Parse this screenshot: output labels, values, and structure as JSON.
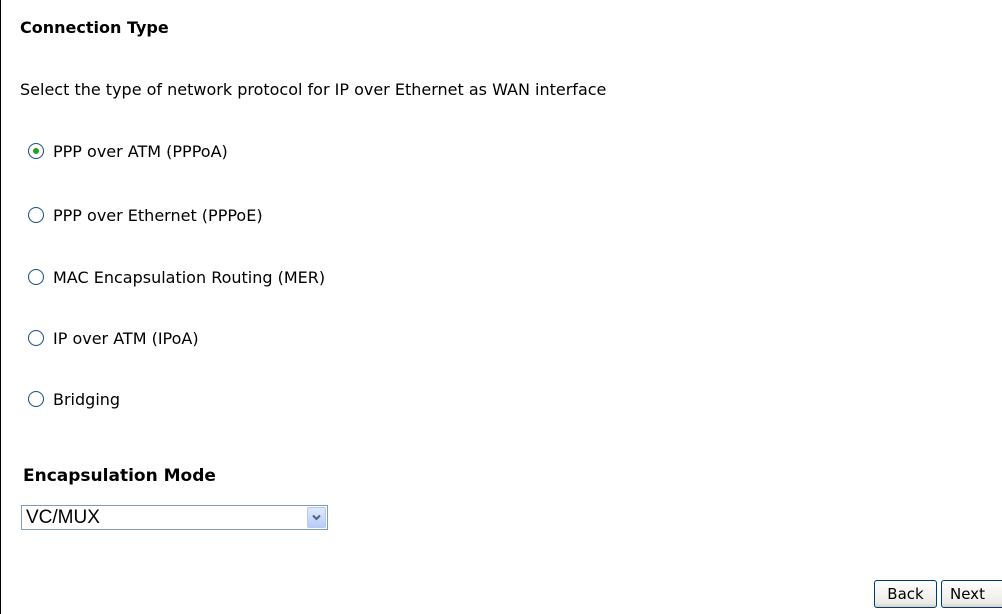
{
  "header": {
    "title": "Connection Type"
  },
  "description": "Select the type of network protocol for IP over Ethernet as WAN interface",
  "connection_types": {
    "selected_index": 0,
    "options": [
      {
        "label": "PPP over ATM (PPPoA)",
        "checked": true
      },
      {
        "label": "PPP over Ethernet (PPPoE)",
        "checked": false
      },
      {
        "label": "MAC Encapsulation Routing (MER)",
        "checked": false
      },
      {
        "label": "IP over ATM (IPoA)",
        "checked": false
      },
      {
        "label": "Bridging",
        "checked": false
      }
    ]
  },
  "encapsulation": {
    "label": "Encapsulation Mode",
    "selected_value": "VC/MUX"
  },
  "buttons": {
    "back_label": "Back",
    "next_label": "Next"
  },
  "colors": {
    "radio_checked_dot": "#21a121",
    "radio_border": "#1c5180",
    "select_border": "#7f9db9",
    "button_border": "#003c74"
  },
  "icons": {
    "radio": "radio-button",
    "dropdown": "chevron-down"
  }
}
